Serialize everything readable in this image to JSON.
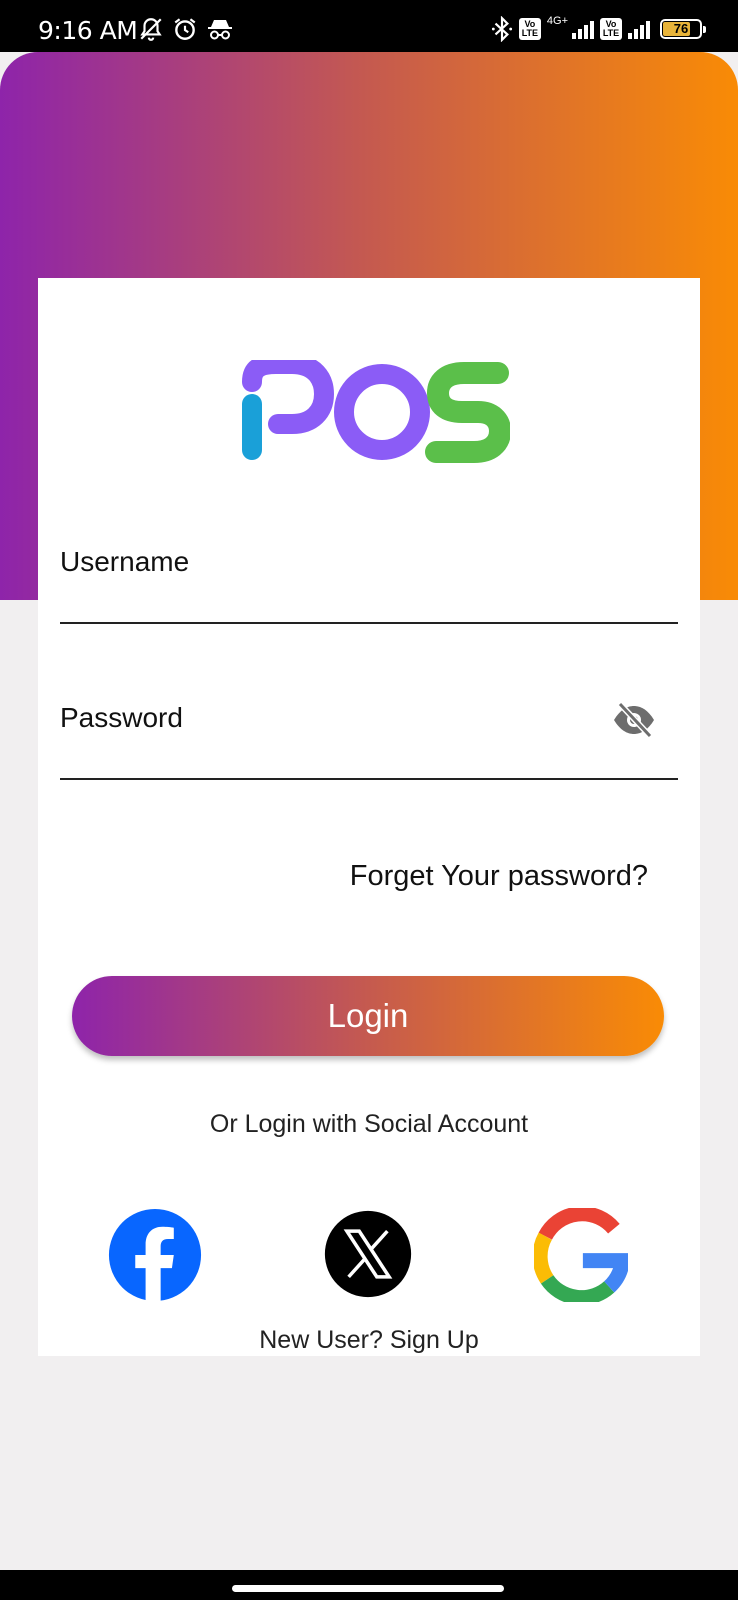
{
  "status_bar": {
    "time": "9:16 AM",
    "net_type": "4G+",
    "volte_badge": "Vo LTE",
    "battery_level": "76",
    "battery_fraction": 0.76,
    "icons": [
      "notification-muted-icon",
      "alarm-icon",
      "incognito-icon",
      "bluetooth-icon",
      "signal-icon",
      "battery-icon"
    ]
  },
  "colors": {
    "gradient_start": "#8e24aa",
    "gradient_mid": "#c55a4f",
    "gradient_end": "#f98b05",
    "logo_purple": "#8b5cf6",
    "logo_blue": "#1aa0d8",
    "logo_green": "#5bbf4a"
  },
  "logo": {
    "text": "POS"
  },
  "form": {
    "username_label": "Username",
    "password_label": "Password",
    "forgot_label": "Forget Your password?",
    "login_label": "Login"
  },
  "social": {
    "caption": "Or Login with Social Account",
    "providers": [
      "facebook-icon",
      "x-icon",
      "google-icon"
    ]
  },
  "signup_label": "New User? Sign Up"
}
